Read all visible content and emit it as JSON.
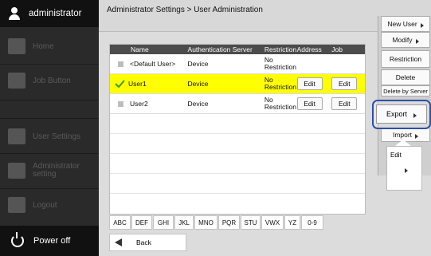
{
  "user": {
    "name": "administrator"
  },
  "sidebar": {
    "items": [
      {
        "label": "Home",
        "icon": "home-icon"
      },
      {
        "label": "Job Button",
        "icon": "job-button-icon"
      },
      {
        "label": "User Settings",
        "icon": "user-settings-icon"
      },
      {
        "label": "Administrator setting",
        "icon": "gear-icon"
      },
      {
        "label": "Logout",
        "icon": "logout-icon"
      }
    ],
    "power_label": "Power off"
  },
  "header": {
    "breadcrumb": "Administrator Settings > User Administration"
  },
  "table": {
    "columns": [
      "Name",
      "Authentication Server",
      "Restriction",
      "Address",
      "Job"
    ],
    "rows": [
      {
        "name": "<Default User>",
        "auth": "Device",
        "restriction": "No Restriction",
        "address": "",
        "job": "",
        "selected": false
      },
      {
        "name": "User1",
        "auth": "Device",
        "restriction": "No Restriction",
        "address": "Edit",
        "job": "Edit",
        "selected": true
      },
      {
        "name": "User2",
        "auth": "Device",
        "restriction": "No Restriction",
        "address": "Edit",
        "job": "Edit",
        "selected": false
      }
    ]
  },
  "alpha": [
    "ABC",
    "DEF",
    "GHI",
    "JKL",
    "MNO",
    "PQR",
    "STU",
    "VWX",
    "YZ",
    "0-9"
  ],
  "back_label": "Back",
  "menu": {
    "new_user": "New User",
    "modify": "Modify",
    "restriction": "Restriction",
    "delete": "Delete",
    "delete_by_server": "Delete by Server",
    "export": "Export",
    "import": "Import",
    "edit": "Edit"
  },
  "colors": {
    "selected_row": "#ffff00",
    "highlight_ring": "#2e4fa8",
    "header_bar": "#4c4c4c"
  }
}
